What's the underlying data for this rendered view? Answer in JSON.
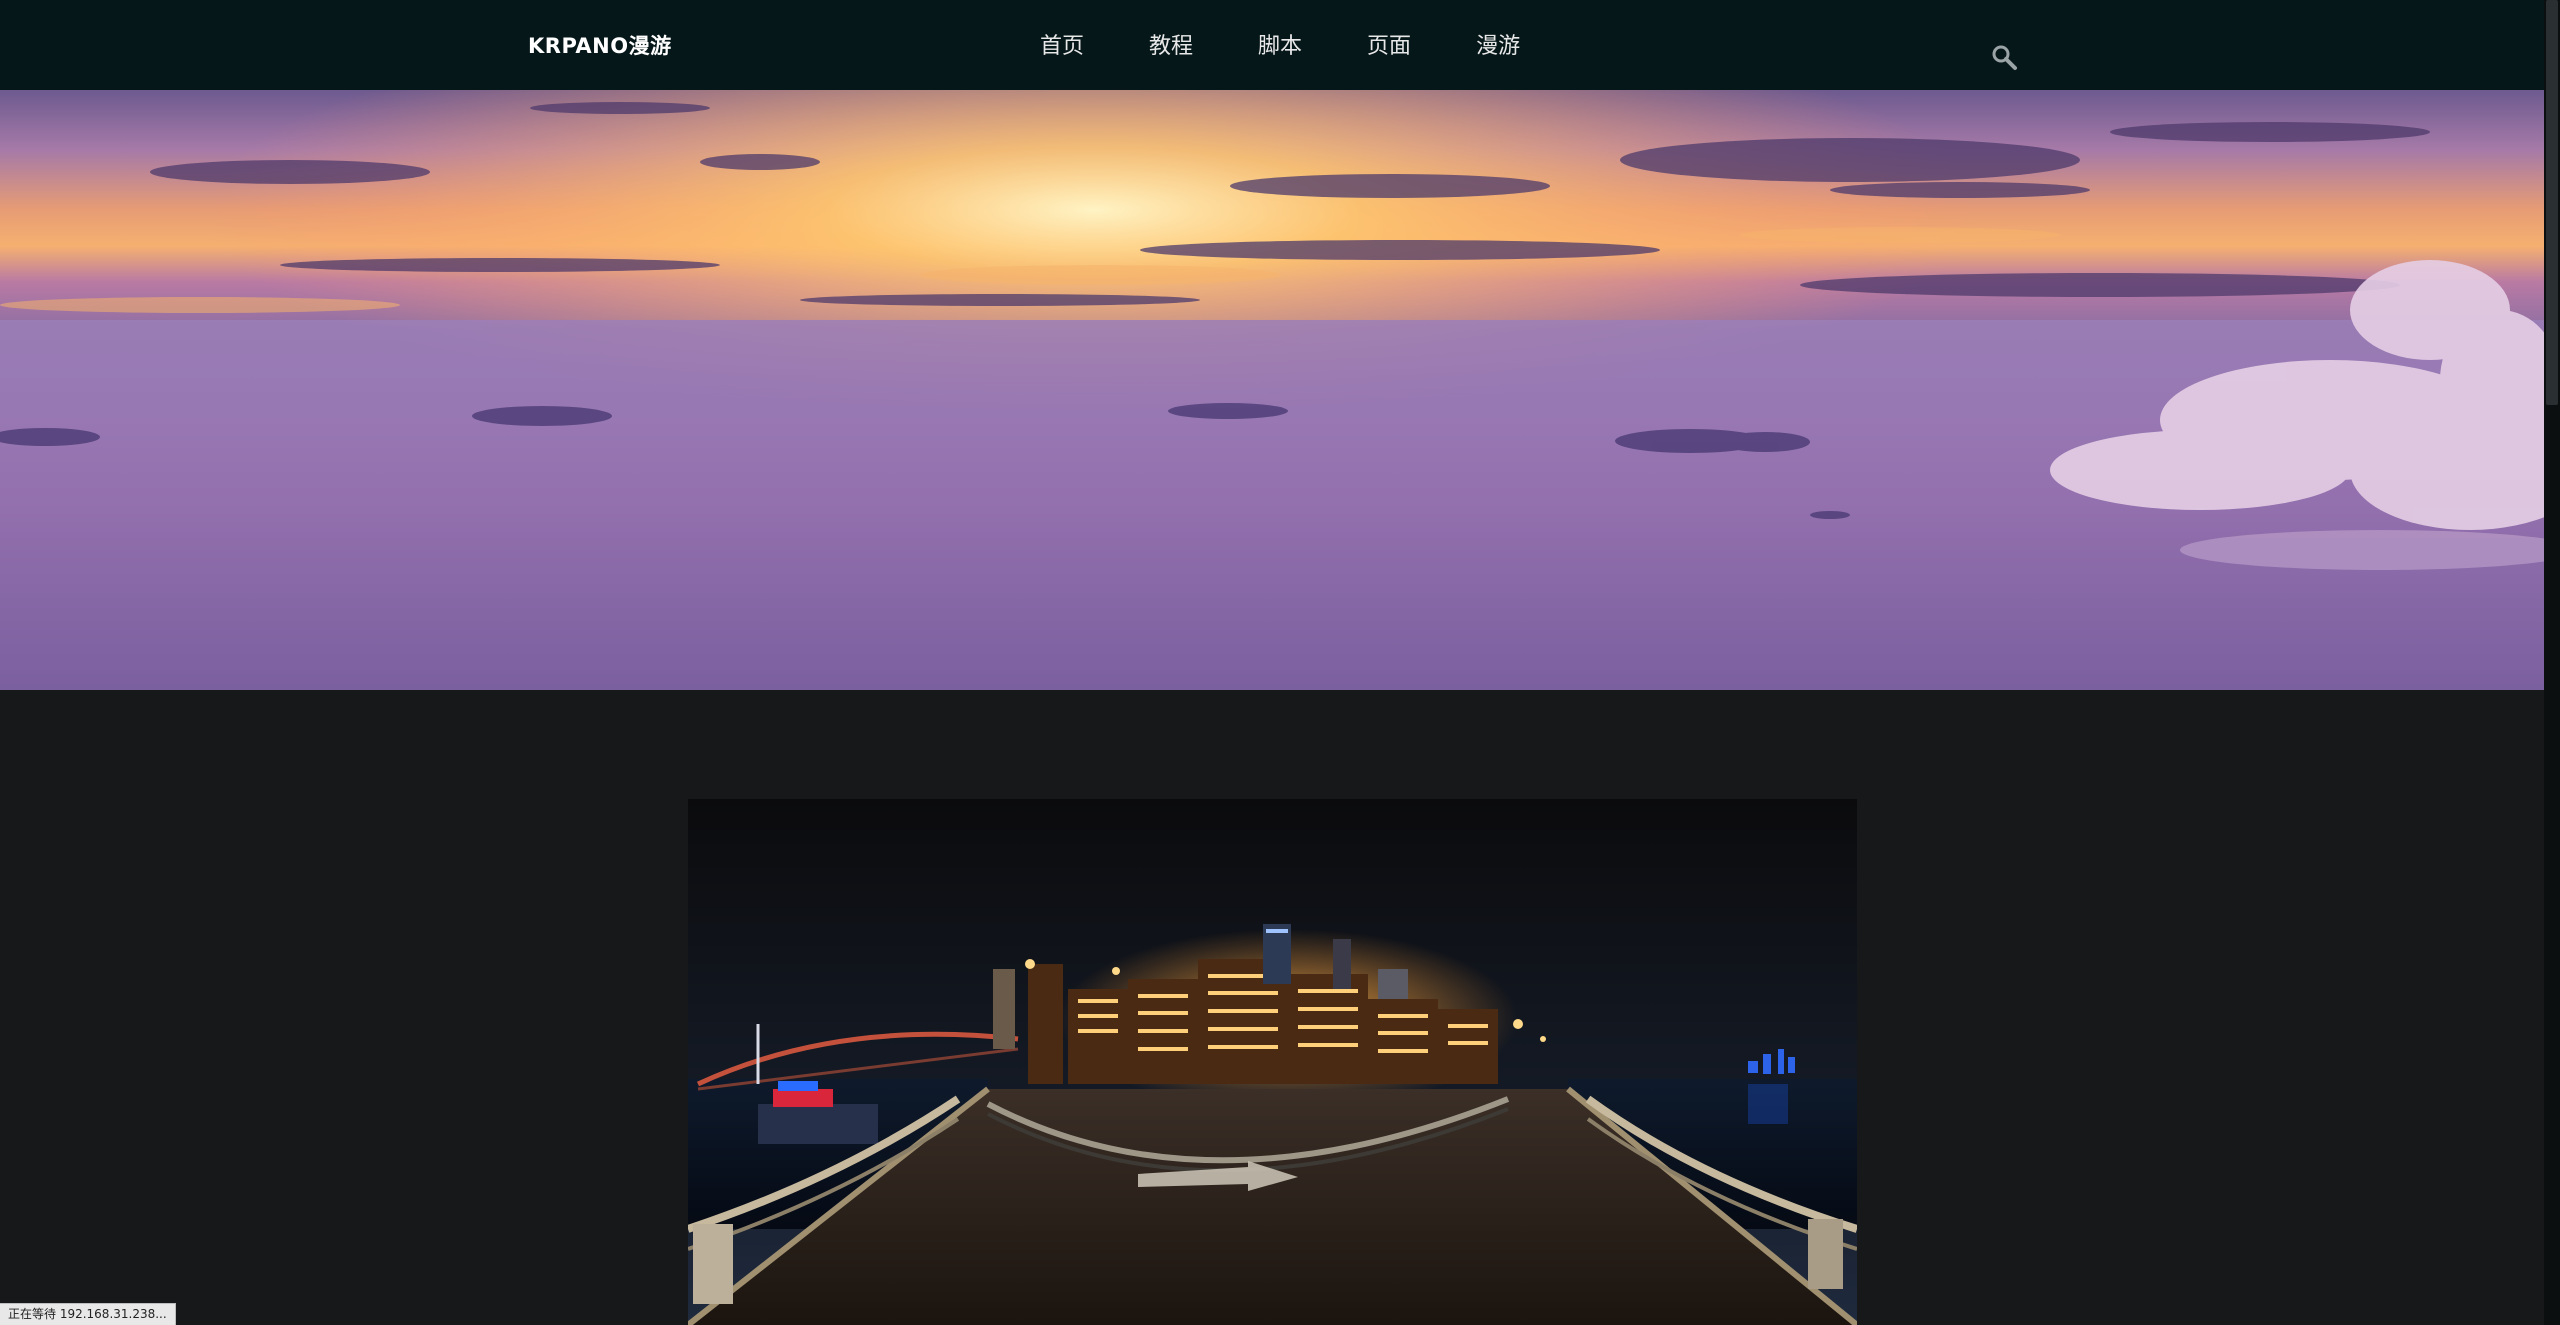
{
  "header": {
    "logo": "KRPANO漫游",
    "nav": [
      "首页",
      "教程",
      "脚本",
      "页面",
      "漫游"
    ],
    "search_icon": "search-icon"
  },
  "hero": {
    "image": "sunset-cloud-sea-panorama"
  },
  "content": {
    "image": "night-city-bridge-panorama"
  },
  "statusbar": {
    "text": "正在等待 192.168.31.238..."
  },
  "colors": {
    "header_bg": "#06171a",
    "page_bg": "#161819",
    "nav_text": "#e8e8e8"
  }
}
